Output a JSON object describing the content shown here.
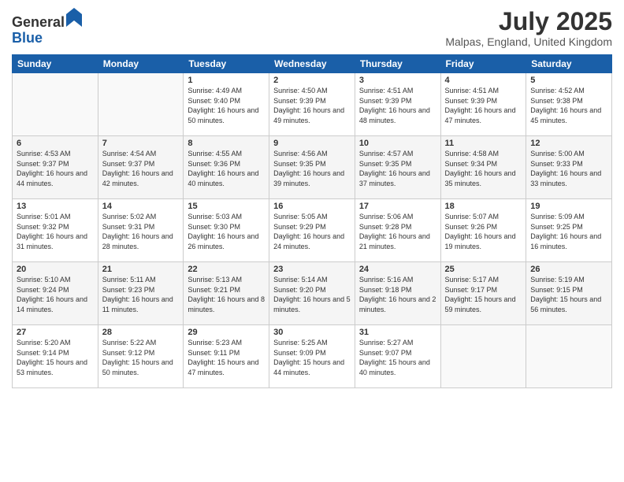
{
  "logo": {
    "general": "General",
    "blue": "Blue"
  },
  "title": "July 2025",
  "location": "Malpas, England, United Kingdom",
  "days_of_week": [
    "Sunday",
    "Monday",
    "Tuesday",
    "Wednesday",
    "Thursday",
    "Friday",
    "Saturday"
  ],
  "weeks": [
    [
      {
        "day": "",
        "sunrise": "",
        "sunset": "",
        "daylight": ""
      },
      {
        "day": "",
        "sunrise": "",
        "sunset": "",
        "daylight": ""
      },
      {
        "day": "1",
        "sunrise": "Sunrise: 4:49 AM",
        "sunset": "Sunset: 9:40 PM",
        "daylight": "Daylight: 16 hours and 50 minutes."
      },
      {
        "day": "2",
        "sunrise": "Sunrise: 4:50 AM",
        "sunset": "Sunset: 9:39 PM",
        "daylight": "Daylight: 16 hours and 49 minutes."
      },
      {
        "day": "3",
        "sunrise": "Sunrise: 4:51 AM",
        "sunset": "Sunset: 9:39 PM",
        "daylight": "Daylight: 16 hours and 48 minutes."
      },
      {
        "day": "4",
        "sunrise": "Sunrise: 4:51 AM",
        "sunset": "Sunset: 9:39 PM",
        "daylight": "Daylight: 16 hours and 47 minutes."
      },
      {
        "day": "5",
        "sunrise": "Sunrise: 4:52 AM",
        "sunset": "Sunset: 9:38 PM",
        "daylight": "Daylight: 16 hours and 45 minutes."
      }
    ],
    [
      {
        "day": "6",
        "sunrise": "Sunrise: 4:53 AM",
        "sunset": "Sunset: 9:37 PM",
        "daylight": "Daylight: 16 hours and 44 minutes."
      },
      {
        "day": "7",
        "sunrise": "Sunrise: 4:54 AM",
        "sunset": "Sunset: 9:37 PM",
        "daylight": "Daylight: 16 hours and 42 minutes."
      },
      {
        "day": "8",
        "sunrise": "Sunrise: 4:55 AM",
        "sunset": "Sunset: 9:36 PM",
        "daylight": "Daylight: 16 hours and 40 minutes."
      },
      {
        "day": "9",
        "sunrise": "Sunrise: 4:56 AM",
        "sunset": "Sunset: 9:35 PM",
        "daylight": "Daylight: 16 hours and 39 minutes."
      },
      {
        "day": "10",
        "sunrise": "Sunrise: 4:57 AM",
        "sunset": "Sunset: 9:35 PM",
        "daylight": "Daylight: 16 hours and 37 minutes."
      },
      {
        "day": "11",
        "sunrise": "Sunrise: 4:58 AM",
        "sunset": "Sunset: 9:34 PM",
        "daylight": "Daylight: 16 hours and 35 minutes."
      },
      {
        "day": "12",
        "sunrise": "Sunrise: 5:00 AM",
        "sunset": "Sunset: 9:33 PM",
        "daylight": "Daylight: 16 hours and 33 minutes."
      }
    ],
    [
      {
        "day": "13",
        "sunrise": "Sunrise: 5:01 AM",
        "sunset": "Sunset: 9:32 PM",
        "daylight": "Daylight: 16 hours and 31 minutes."
      },
      {
        "day": "14",
        "sunrise": "Sunrise: 5:02 AM",
        "sunset": "Sunset: 9:31 PM",
        "daylight": "Daylight: 16 hours and 28 minutes."
      },
      {
        "day": "15",
        "sunrise": "Sunrise: 5:03 AM",
        "sunset": "Sunset: 9:30 PM",
        "daylight": "Daylight: 16 hours and 26 minutes."
      },
      {
        "day": "16",
        "sunrise": "Sunrise: 5:05 AM",
        "sunset": "Sunset: 9:29 PM",
        "daylight": "Daylight: 16 hours and 24 minutes."
      },
      {
        "day": "17",
        "sunrise": "Sunrise: 5:06 AM",
        "sunset": "Sunset: 9:28 PM",
        "daylight": "Daylight: 16 hours and 21 minutes."
      },
      {
        "day": "18",
        "sunrise": "Sunrise: 5:07 AM",
        "sunset": "Sunset: 9:26 PM",
        "daylight": "Daylight: 16 hours and 19 minutes."
      },
      {
        "day": "19",
        "sunrise": "Sunrise: 5:09 AM",
        "sunset": "Sunset: 9:25 PM",
        "daylight": "Daylight: 16 hours and 16 minutes."
      }
    ],
    [
      {
        "day": "20",
        "sunrise": "Sunrise: 5:10 AM",
        "sunset": "Sunset: 9:24 PM",
        "daylight": "Daylight: 16 hours and 14 minutes."
      },
      {
        "day": "21",
        "sunrise": "Sunrise: 5:11 AM",
        "sunset": "Sunset: 9:23 PM",
        "daylight": "Daylight: 16 hours and 11 minutes."
      },
      {
        "day": "22",
        "sunrise": "Sunrise: 5:13 AM",
        "sunset": "Sunset: 9:21 PM",
        "daylight": "Daylight: 16 hours and 8 minutes."
      },
      {
        "day": "23",
        "sunrise": "Sunrise: 5:14 AM",
        "sunset": "Sunset: 9:20 PM",
        "daylight": "Daylight: 16 hours and 5 minutes."
      },
      {
        "day": "24",
        "sunrise": "Sunrise: 5:16 AM",
        "sunset": "Sunset: 9:18 PM",
        "daylight": "Daylight: 16 hours and 2 minutes."
      },
      {
        "day": "25",
        "sunrise": "Sunrise: 5:17 AM",
        "sunset": "Sunset: 9:17 PM",
        "daylight": "Daylight: 15 hours and 59 minutes."
      },
      {
        "day": "26",
        "sunrise": "Sunrise: 5:19 AM",
        "sunset": "Sunset: 9:15 PM",
        "daylight": "Daylight: 15 hours and 56 minutes."
      }
    ],
    [
      {
        "day": "27",
        "sunrise": "Sunrise: 5:20 AM",
        "sunset": "Sunset: 9:14 PM",
        "daylight": "Daylight: 15 hours and 53 minutes."
      },
      {
        "day": "28",
        "sunrise": "Sunrise: 5:22 AM",
        "sunset": "Sunset: 9:12 PM",
        "daylight": "Daylight: 15 hours and 50 minutes."
      },
      {
        "day": "29",
        "sunrise": "Sunrise: 5:23 AM",
        "sunset": "Sunset: 9:11 PM",
        "daylight": "Daylight: 15 hours and 47 minutes."
      },
      {
        "day": "30",
        "sunrise": "Sunrise: 5:25 AM",
        "sunset": "Sunset: 9:09 PM",
        "daylight": "Daylight: 15 hours and 44 minutes."
      },
      {
        "day": "31",
        "sunrise": "Sunrise: 5:27 AM",
        "sunset": "Sunset: 9:07 PM",
        "daylight": "Daylight: 15 hours and 40 minutes."
      },
      {
        "day": "",
        "sunrise": "",
        "sunset": "",
        "daylight": ""
      },
      {
        "day": "",
        "sunrise": "",
        "sunset": "",
        "daylight": ""
      }
    ]
  ]
}
